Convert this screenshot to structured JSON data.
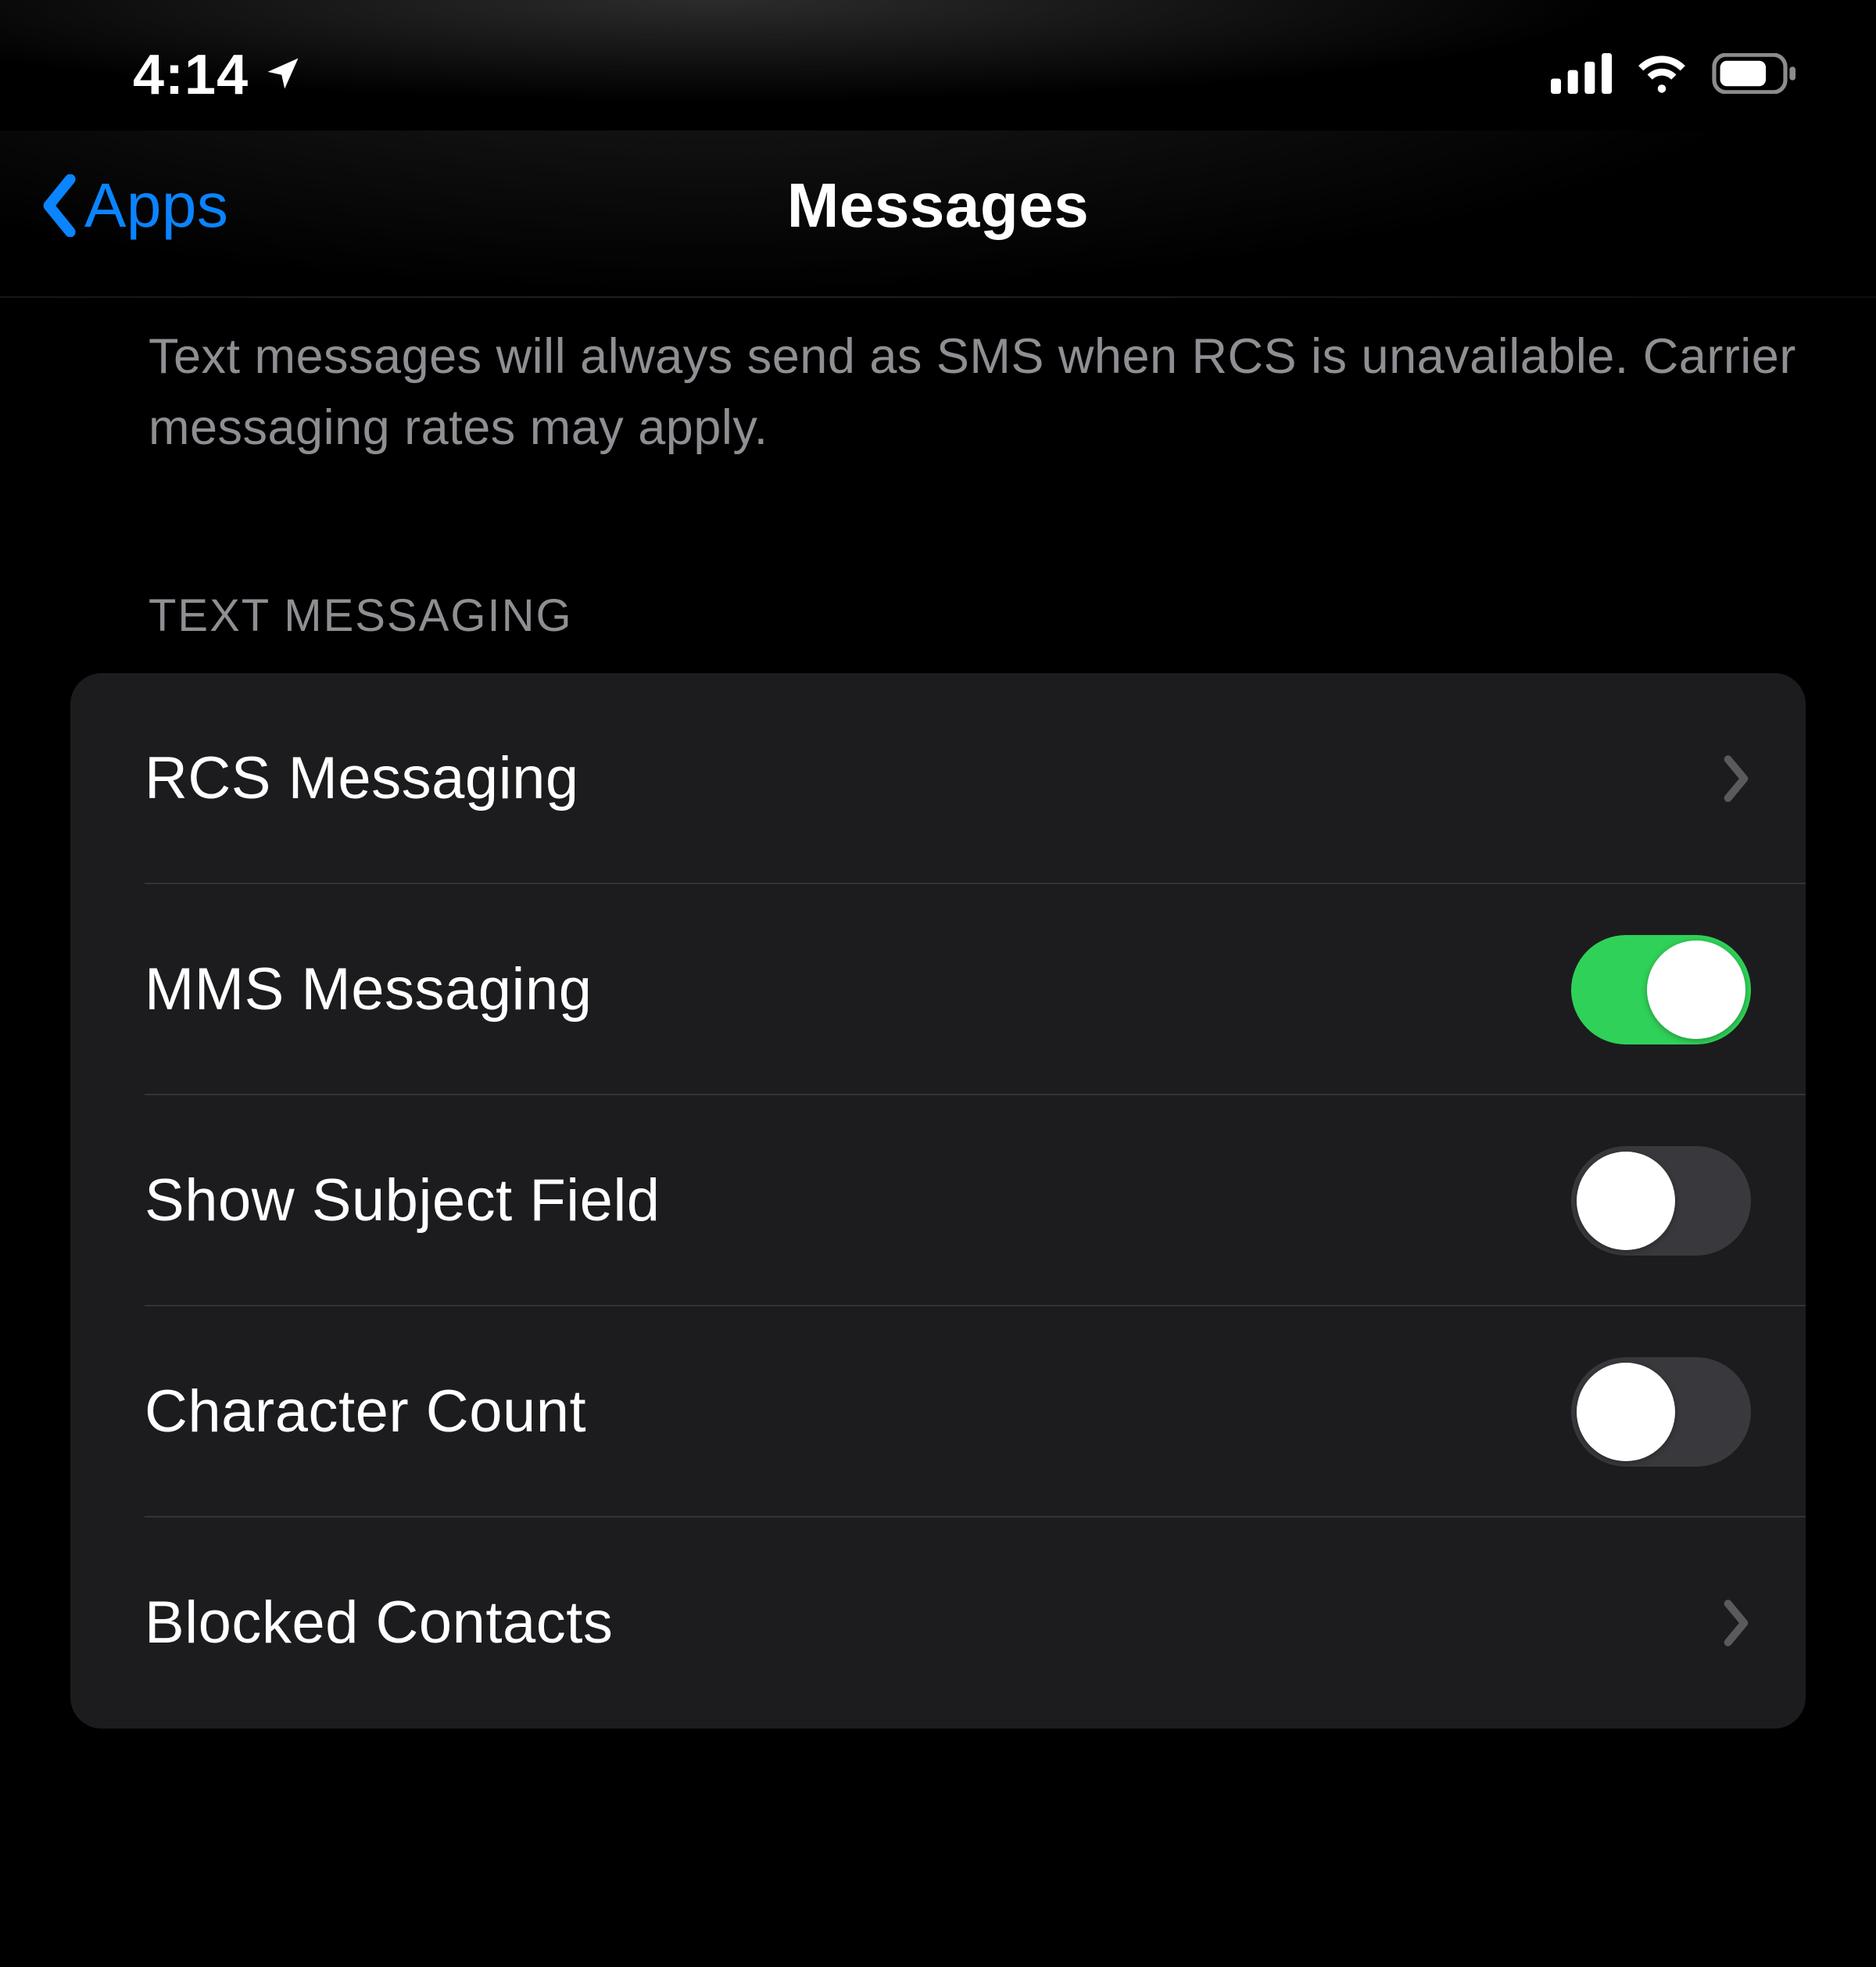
{
  "statusbar": {
    "time": "4:14"
  },
  "nav": {
    "back_label": "Apps",
    "title": "Messages"
  },
  "description": "Text messages will always send as SMS when RCS is unavailable. Carrier messaging rates may apply.",
  "section": {
    "header": "TEXT MESSAGING",
    "rows": {
      "rcs_messaging": {
        "label": "RCS Messaging",
        "type": "disclosure"
      },
      "mms_messaging": {
        "label": "MMS Messaging",
        "type": "toggle",
        "value": true
      },
      "show_subject_field": {
        "label": "Show Subject Field",
        "type": "toggle",
        "value": false
      },
      "character_count": {
        "label": "Character Count",
        "type": "toggle",
        "value": false
      },
      "blocked_contacts": {
        "label": "Blocked Contacts",
        "type": "disclosure"
      }
    }
  },
  "colors": {
    "accent_blue": "#0a84ff",
    "toggle_on": "#30d158",
    "toggle_off": "#39393d",
    "group_bg": "#1c1c1e",
    "secondary_text": "#8e8e93"
  }
}
